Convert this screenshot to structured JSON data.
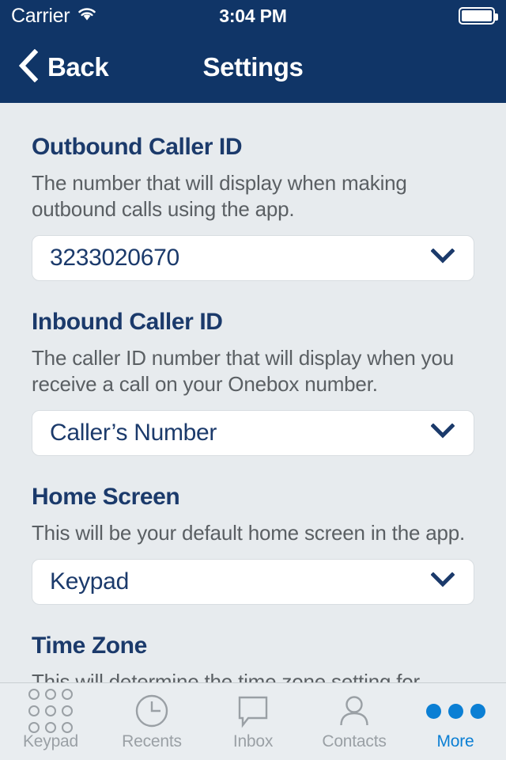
{
  "status_bar": {
    "carrier": "Carrier",
    "wifi_icon": "wifi-icon",
    "time": "3:04 PM",
    "battery_icon": "battery-full-icon"
  },
  "nav_bar": {
    "back_label": "Back",
    "back_icon": "chevron-left-icon",
    "title": "Settings"
  },
  "colors": {
    "nav_background": "#103567",
    "page_background": "#e7ebee",
    "heading": "#1b3a6b",
    "body_text": "#5a5f63",
    "field_text": "#1b3a6b",
    "tab_inactive": "#9aa0a5",
    "tab_active": "#0b7fd4"
  },
  "sections": [
    {
      "title": "Outbound Caller ID",
      "description": "The number that will display when making outbound calls using the app.",
      "field_value": "3233020670",
      "chevron_icon": "chevron-down-icon"
    },
    {
      "title": "Inbound Caller ID",
      "description": "The caller ID number that will display when you receive a call on your Onebox number.",
      "field_value": "Caller’s Number",
      "chevron_icon": "chevron-down-icon"
    },
    {
      "title": "Home Screen",
      "description": "This will be your default home screen in the app.",
      "field_value": "Keypad",
      "chevron_icon": "chevron-down-icon"
    },
    {
      "title": "Time Zone",
      "description": "This will determine the time zone setting for",
      "field_value": null,
      "chevron_icon": null
    }
  ],
  "tab_bar": {
    "tabs": [
      {
        "label": "Keypad",
        "icon": "keypad-grid-icon",
        "active": false
      },
      {
        "label": "Recents",
        "icon": "clock-icon",
        "active": false
      },
      {
        "label": "Inbox",
        "icon": "speech-bubble-icon",
        "active": false
      },
      {
        "label": "Contacts",
        "icon": "person-icon",
        "active": false
      },
      {
        "label": "More",
        "icon": "three-dots-icon",
        "active": true
      }
    ]
  }
}
